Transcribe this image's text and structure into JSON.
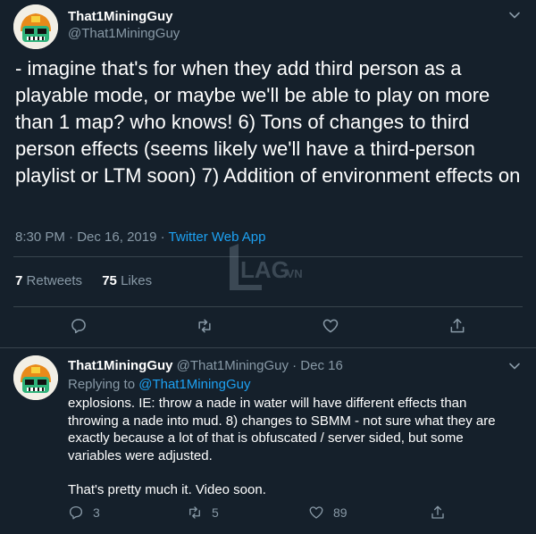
{
  "main_tweet": {
    "author_name": "That1MiningGuy",
    "author_handle": "@That1MiningGuy",
    "text": "- imagine that's for when they add third person as a playable mode, or maybe we'll be able to play on more than 1 map? who knows! 6) Tons of changes to third person effects (seems likely we'll have a third-person playlist or LTM soon) 7) Addition of environment effects on",
    "time": "8:30 PM",
    "separator": "·",
    "date": "Dec 16, 2019",
    "source": "Twitter Web App",
    "retweets_count": "7",
    "retweets_label": "Retweets",
    "likes_count": "75",
    "likes_label": "Likes",
    "actions": [
      "reply-icon",
      "retweet-icon",
      "like-icon",
      "share-icon"
    ]
  },
  "watermark": {
    "text_main": "LAG",
    "text_suffix": ".VN"
  },
  "reply_tweet": {
    "author_name": "That1MiningGuy",
    "author_handle": "@That1MiningGuy",
    "separator": "·",
    "date": "Dec 16",
    "replying_prefix": "Replying to",
    "replying_handle": "@That1MiningGuy",
    "paragraph_1": "explosions. IE: throw a nade in water will have different effects than throwing a nade into mud. 8) changes to SBMM - not sure what they are exactly because a lot of that is obfuscated / server sided, but some variables were adjusted.",
    "paragraph_2": "That's pretty much it. Video soon.",
    "reply_count": "3",
    "retweet_count": "5",
    "like_count": "89"
  },
  "colors": {
    "background": "#15202b",
    "text": "#ffffff",
    "muted": "#8899a6",
    "accent": "#1da1f2",
    "border": "#38444d"
  }
}
